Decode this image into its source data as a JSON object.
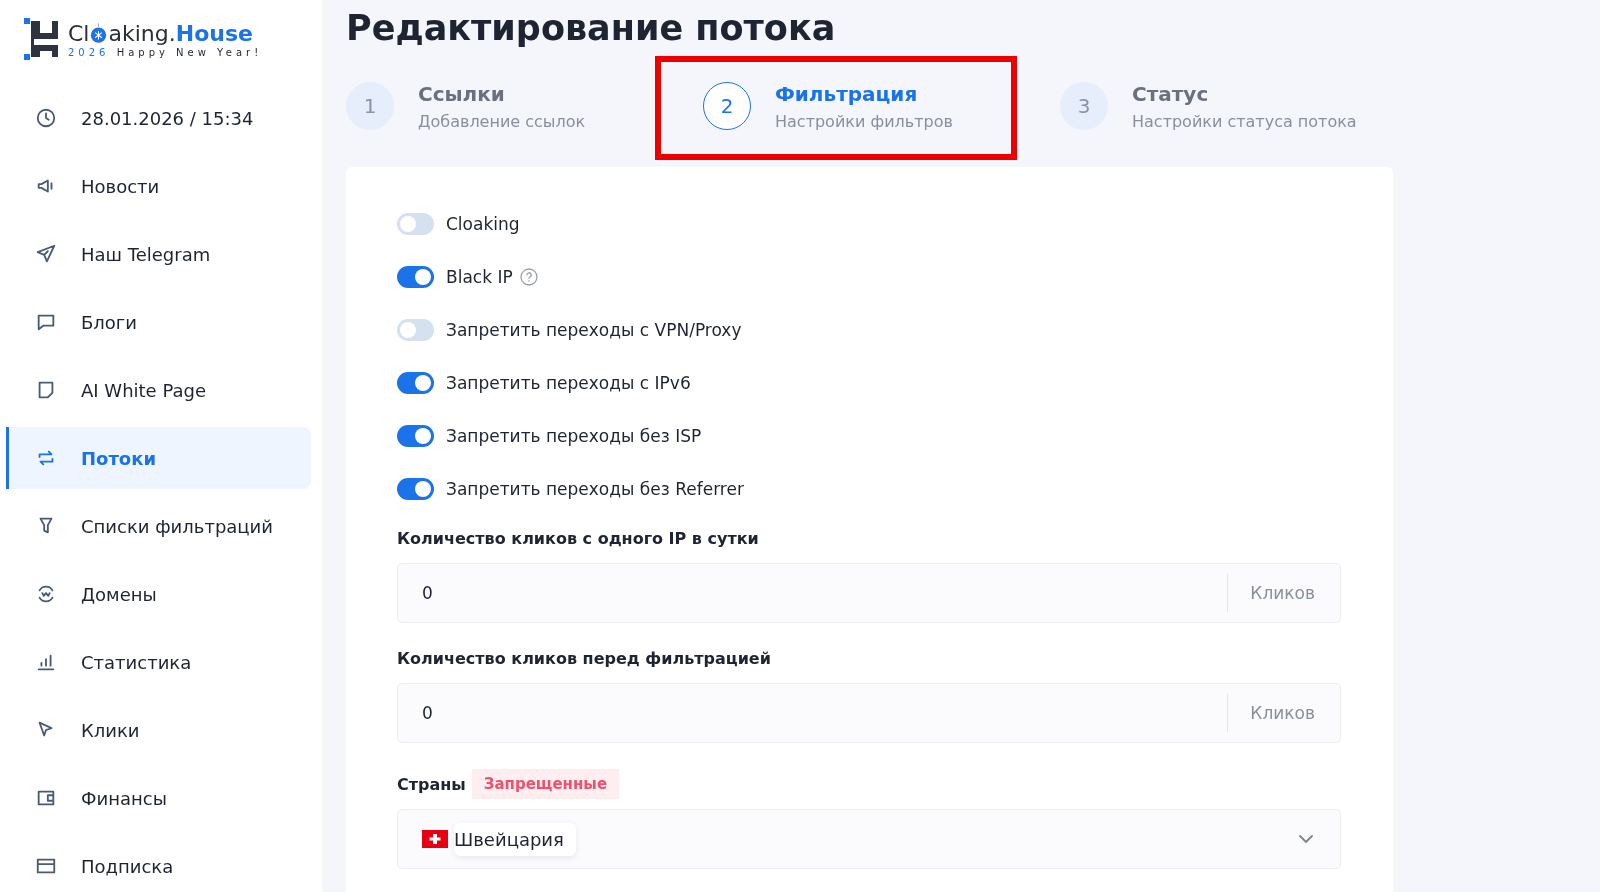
{
  "logo": {
    "text_start": "Cl",
    "text_end": "aking.",
    "brand": "House",
    "year": "2026",
    "tagline": "Happy New Year!"
  },
  "sidebar": {
    "items": [
      {
        "label": "28.01.2026 / 15:34",
        "selected": false
      },
      {
        "label": "Новости",
        "selected": false
      },
      {
        "label": "Наш Telegram",
        "selected": false
      },
      {
        "label": "Блоги",
        "selected": false
      },
      {
        "label": "AI White Page",
        "selected": false
      },
      {
        "label": "Потоки",
        "selected": true
      },
      {
        "label": "Списки фильтраций",
        "selected": false
      },
      {
        "label": "Домены",
        "selected": false
      },
      {
        "label": "Статистика",
        "selected": false
      },
      {
        "label": "Клики",
        "selected": false
      },
      {
        "label": "Финансы",
        "selected": false
      },
      {
        "label": "Подписка",
        "selected": false
      }
    ]
  },
  "page_title": "Редактирование потока",
  "steps": [
    {
      "number": "1",
      "title": "Ссылки",
      "subtitle": "Добавление ссылок",
      "selected": false,
      "highlighted": false
    },
    {
      "number": "2",
      "title": "Фильтрация",
      "subtitle": "Настройки фильтров",
      "selected": true,
      "highlighted": true
    },
    {
      "number": "3",
      "title": "Статус",
      "subtitle": "Настройки статуса потока",
      "selected": false,
      "highlighted": false
    }
  ],
  "toggles": [
    {
      "label": "Cloaking",
      "on": false,
      "help": false
    },
    {
      "label": "Black IP",
      "on": true,
      "help": true
    },
    {
      "label": "Запретить переходы с VPN/Proxy",
      "on": false,
      "help": false
    },
    {
      "label": "Запретить переходы с IPv6",
      "on": true,
      "help": false
    },
    {
      "label": "Запретить переходы без ISP",
      "on": true,
      "help": false
    },
    {
      "label": "Запретить переходы без Referrer",
      "on": true,
      "help": false
    }
  ],
  "fields": [
    {
      "label": "Количество кликов с одного IP в сутки",
      "value": "0",
      "suffix": "Кликов"
    },
    {
      "label": "Количество кликов перед фильтрацией",
      "value": "0",
      "suffix": "Кликов"
    }
  ],
  "countries": {
    "label": "Страны",
    "mode": "Запрещенные",
    "selected": [
      {
        "name": "Швейцария"
      }
    ]
  }
}
